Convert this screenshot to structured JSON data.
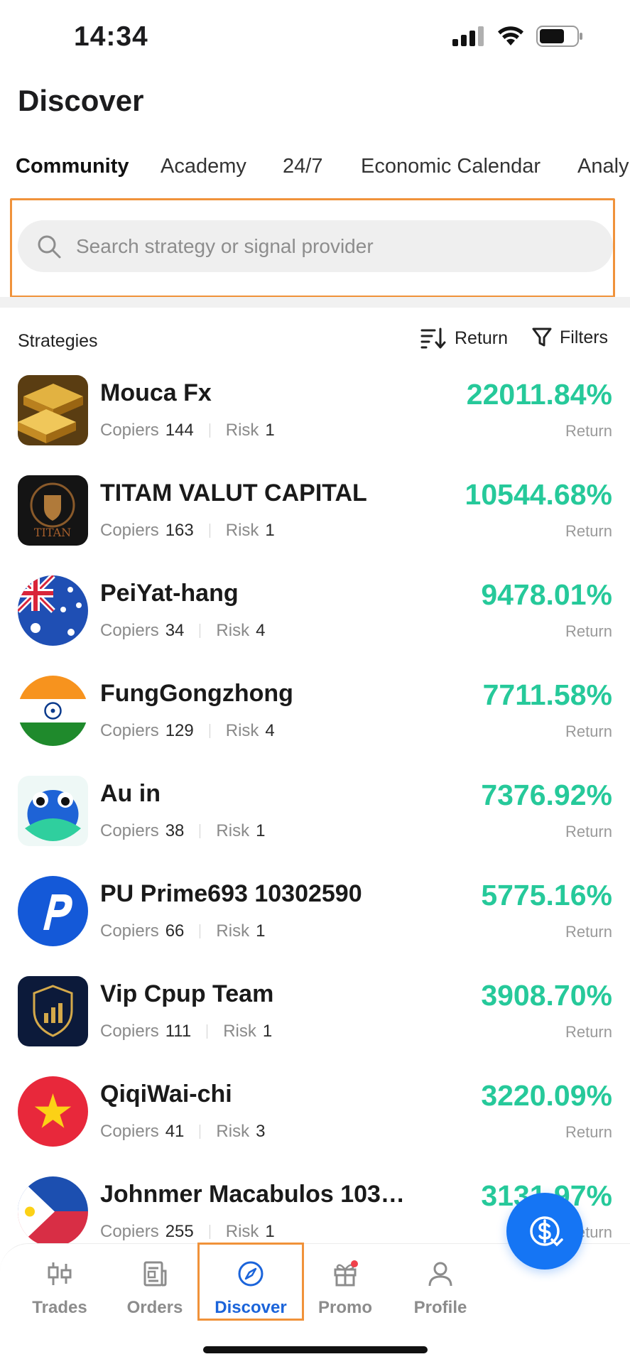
{
  "status_bar": {
    "time": "14:34"
  },
  "page": {
    "title": "Discover"
  },
  "tabs": [
    "Community",
    "Academy",
    "24/7",
    "Economic Calendar",
    "Analy"
  ],
  "search": {
    "placeholder": "Search strategy or signal provider"
  },
  "list_header": {
    "label": "Strategies",
    "sort_label": "Return",
    "filter_label": "Filters"
  },
  "labels": {
    "copiers": "Copiers",
    "risk": "Risk",
    "return": "Return"
  },
  "strategies": [
    {
      "name": "Mouca Fx",
      "copiers": "144",
      "risk": "1",
      "return": "22011.84%"
    },
    {
      "name": "TITAM VALUT CAPITAL",
      "copiers": "163",
      "risk": "1",
      "return": "10544.68%"
    },
    {
      "name": "PeiYat-hang",
      "copiers": "34",
      "risk": "4",
      "return": "9478.01%"
    },
    {
      "name": "FungGongzhong",
      "copiers": "129",
      "risk": "4",
      "return": "7711.58%"
    },
    {
      "name": "Au in",
      "copiers": "38",
      "risk": "1",
      "return": "7376.92%"
    },
    {
      "name": "PU Prime693 10302590",
      "copiers": "66",
      "risk": "1",
      "return": "5775.16%"
    },
    {
      "name": "Vip Cpup Team",
      "copiers": "111",
      "risk": "1",
      "return": "3908.70%"
    },
    {
      "name": "QiqiWai-chi",
      "copiers": "41",
      "risk": "3",
      "return": "3220.09%"
    },
    {
      "name": "Johnmer Macabulos 1032...",
      "copiers": "255",
      "risk": "1",
      "return": "3131.97%"
    }
  ],
  "avatar_logo_text": "TITAN",
  "bottom_nav": [
    {
      "label": "Trades",
      "icon": "trades-icon"
    },
    {
      "label": "Orders",
      "icon": "orders-icon"
    },
    {
      "label": "Discover",
      "icon": "compass-icon"
    },
    {
      "label": "Promo",
      "icon": "gift-icon"
    },
    {
      "label": "Profile",
      "icon": "user-icon"
    }
  ],
  "colors": {
    "accent": "#1b64da",
    "return_green": "#26c99a",
    "fab": "#1575f4",
    "highlight": "#f0923a"
  }
}
